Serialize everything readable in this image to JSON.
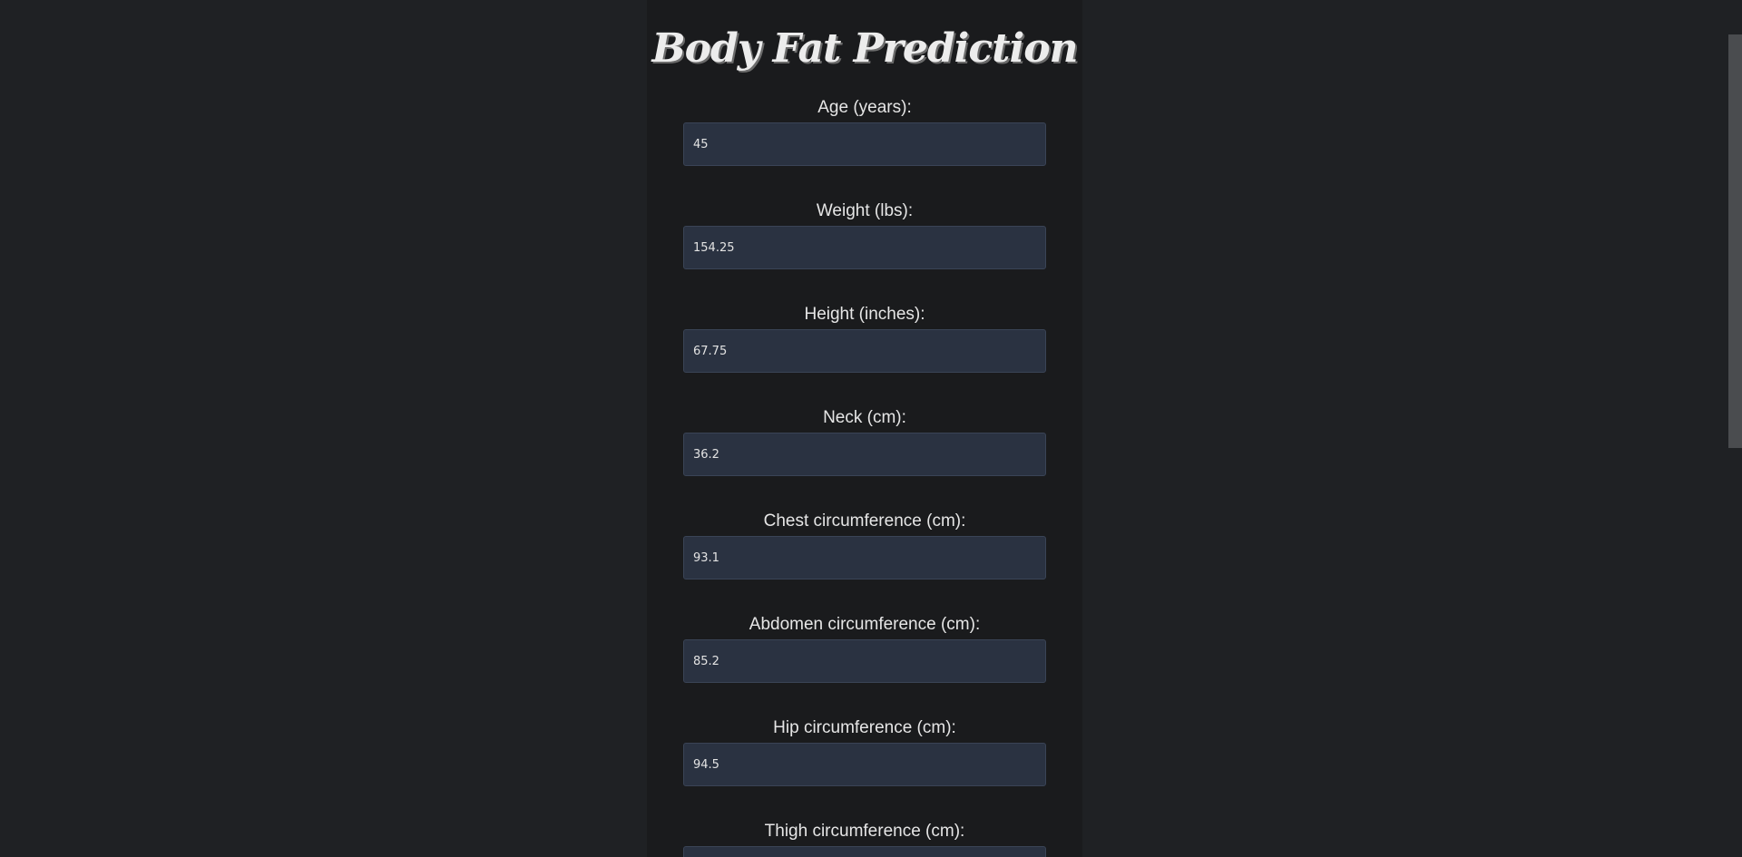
{
  "page": {
    "title": "Body Fat Prediction"
  },
  "form": {
    "fields": [
      {
        "label": "Age (years):",
        "value": "45"
      },
      {
        "label": "Weight (lbs):",
        "value": "154.25"
      },
      {
        "label": "Height (inches):",
        "value": "67.75"
      },
      {
        "label": "Neck (cm):",
        "value": "36.2"
      },
      {
        "label": "Chest circumference (cm):",
        "value": "93.1"
      },
      {
        "label": "Abdomen circumference (cm):",
        "value": "85.2"
      },
      {
        "label": "Hip circumference (cm):",
        "value": "94.5"
      },
      {
        "label": "Thigh circumference (cm):",
        "value": ""
      }
    ]
  },
  "colors": {
    "background": "#1f2124",
    "panel": "#1a1b1d",
    "input_background": "#2a3241",
    "text": "#e6e6e6"
  }
}
